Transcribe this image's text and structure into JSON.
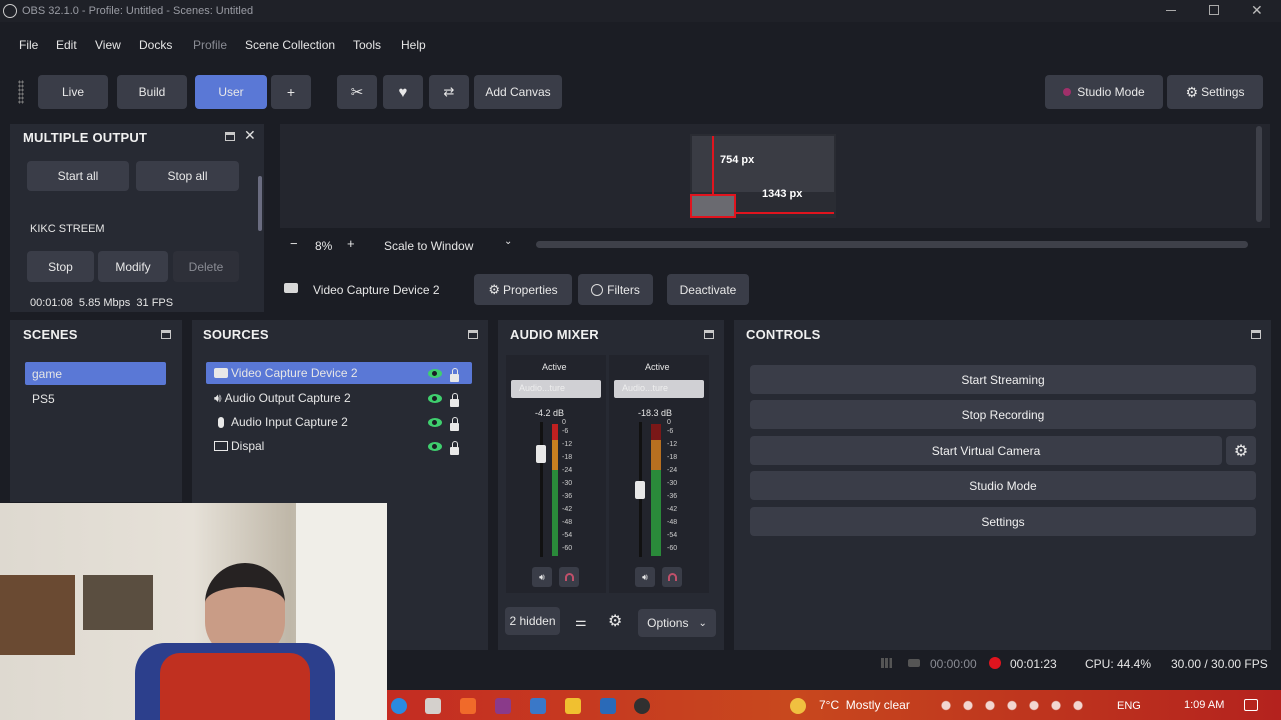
{
  "window": {
    "title": "OBS 32.1.0 - Profile: Untitled - Scenes: Untitled"
  },
  "menu": [
    "File",
    "Edit",
    "View",
    "Docks",
    "Profile",
    "Scene Collection",
    "Tools",
    "Help"
  ],
  "toolbar": {
    "live": "Live",
    "build": "Build",
    "user": "User",
    "add": "+",
    "add_canvas": "Add Canvas",
    "studio_mode": "Studio Mode",
    "settings": "Settings"
  },
  "multiple_output": {
    "title": "MULTIPLE OUTPUT",
    "start_all": "Start all",
    "stop_all": "Stop all",
    "stream_name": "KIKC STREEM",
    "stop": "Stop",
    "modify": "Modify",
    "delete": "Delete",
    "stats": "00:01:08  5.85 Mbps  31 FPS"
  },
  "preview": {
    "label_height": "754 px",
    "label_width": "1343 px",
    "zoom_minus": "−",
    "zoom": "8%",
    "zoom_plus": "+",
    "scale_mode": "Scale to Window"
  },
  "source_toolbar": {
    "selected_source": "Video Capture Device 2",
    "properties": "Properties",
    "filters": "Filters",
    "deactivate": "Deactivate"
  },
  "scenes": {
    "title": "SCENES",
    "items": [
      "game",
      "PS5"
    ],
    "selected": "game"
  },
  "sources": {
    "title": "SOURCES",
    "items": [
      {
        "label": "Video Capture Device 2",
        "icon": "camera-icon"
      },
      {
        "label": "Audio Output Capture 2",
        "icon": "speaker-icon"
      },
      {
        "label": "Audio Input Capture 2",
        "icon": "microphone-icon"
      },
      {
        "label": "Dispal",
        "icon": "monitor-icon"
      }
    ]
  },
  "audio_mixer": {
    "title": "AUDIO MIXER",
    "channels": [
      {
        "status": "Active",
        "name": "Audio...ture",
        "db": "-4.2 dB"
      },
      {
        "status": "Active",
        "name": "Audio...ture",
        "db": "-18.3 dB"
      }
    ],
    "scale": [
      "0",
      "-6",
      "-12",
      "-18",
      "-24",
      "-30",
      "-36",
      "-42",
      "-48",
      "-54",
      "-60"
    ],
    "hidden": "2 hidden",
    "options": "Options"
  },
  "controls": {
    "title": "CONTROLS",
    "start_streaming": "Start Streaming",
    "stop_recording": "Stop Recording",
    "start_virtual_camera": "Start Virtual Camera",
    "studio_mode": "Studio Mode",
    "settings": "Settings"
  },
  "status_bar": {
    "stream_time": "00:00:00",
    "rec_time": "00:01:23",
    "cpu": "CPU: 44.4%",
    "fps": "30.00 / 30.00 FPS"
  },
  "taskbar": {
    "weather": "7°C  Mostly clear",
    "lang": "ENG",
    "time": "1:09 AM"
  },
  "colors": {
    "accent": "#5a78d6",
    "bg": "#1b1d24",
    "panel": "#272a33",
    "button": "#3a3d48",
    "rec": "#e0141e",
    "eye": "#3fcf6e"
  }
}
